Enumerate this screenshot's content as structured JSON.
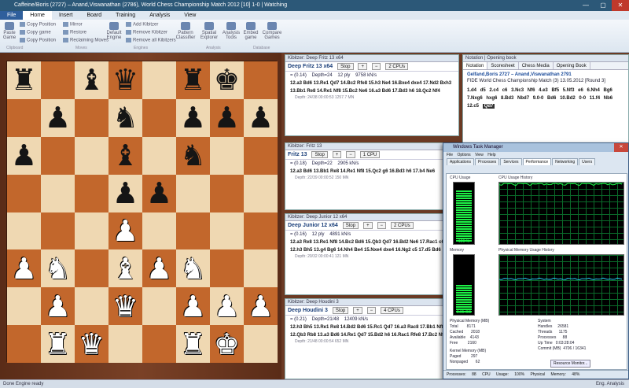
{
  "window": {
    "title": "Caffeine/Boris (2727) – Anand,Viswanathan (2786), World Chess Championship Match 2012 [10] 1-0 | Watching",
    "controls": [
      "—",
      "▢",
      "✕"
    ]
  },
  "menu": [
    "File",
    "Home",
    "Insert",
    "Board",
    "Training",
    "Analysis",
    "View"
  ],
  "ribbon": {
    "left_buttons": [
      "Paste Game",
      "Copy Game"
    ],
    "small_items": [
      "Copy Position",
      "Copy game",
      "Copy Position",
      "Mirror",
      "Restore",
      "Reclaiming Moves",
      "Add Kibitzer",
      "Remove Kibitzer",
      "Remove all Kibitzers"
    ],
    "buttons": [
      "Default Engine",
      "Pattern Classifier",
      "Spatial Explorer",
      "Analysis Tools",
      "Embed game",
      "Compare Games"
    ],
    "groups": [
      "Clipboard",
      "Moves",
      "Engines",
      "Analysis",
      "Database"
    ]
  },
  "board": [
    [
      "bR",
      "",
      "bB",
      "bQ",
      "",
      "bR",
      "bK",
      ""
    ],
    [
      "",
      "bP",
      "",
      "bN",
      "",
      "bP",
      "bP",
      "bP"
    ],
    [
      "bP",
      "",
      "",
      "bB",
      "",
      "bN",
      "",
      ""
    ],
    [
      "",
      "",
      "",
      "bP",
      "bP",
      "",
      "",
      ""
    ],
    [
      "",
      "",
      "",
      "wP",
      "",
      "",
      "",
      ""
    ],
    [
      "wP",
      "wN",
      "",
      "wB",
      "wP",
      "wN",
      "",
      ""
    ],
    [
      "",
      "wP",
      "",
      "wQ",
      "",
      "wP",
      "wP",
      "wP"
    ],
    [
      "",
      "wR",
      "wQ",
      "",
      "",
      "wR",
      "wK",
      ""
    ]
  ],
  "engines": [
    {
      "header": "Kibitzer: Deep Fritz 13 x64",
      "name": "Deep Fritz 13 x64",
      "buttons": [
        "Stop",
        "+",
        "−",
        "2 CPUs"
      ],
      "info": [
        "= (0.14)",
        "Depth=24",
        "12 ply",
        "9758 kN/s"
      ],
      "lines": [
        "12.a3 Bd6 13.Re1 Qd7 14.Bc2 Rfe8 15.h3 Ne4 16.Bxe4 dxe4 17.Nd2 Bxh3",
        "13.Bb1 Re8 14.Re1 Nf8 15.Bc2 Ne6 16.a3 Bd6 17.Bd3 h6 18.Qc2 Nf4"
      ],
      "depth": "Depth: 24/38 00:00:53 1257.7 MN"
    },
    {
      "header": "Kibitzer: Fritz 13",
      "name": "Fritz 13",
      "buttons": [
        "Stop",
        "+",
        "−",
        "1 CPU"
      ],
      "info": [
        "= (0.18)",
        "Depth=22",
        "2905 kN/s"
      ],
      "lines": [
        "12.a3 Bd6 13.Bb1 Re8 14.Re1 Nf8 15.Qc2 g6 16.Bd3 h6 17.b4 Ne6"
      ],
      "depth": "Depth: 22/39 00:00:52 150 MN"
    },
    {
      "header": "Kibitzer: Deep Junior 12 x64",
      "name": "Deep Junior 12 x64",
      "buttons": [
        "Stop",
        "+",
        "−",
        "2 CPUs"
      ],
      "info": [
        "= (0.16)",
        "12 ply",
        "4891 kN/s"
      ],
      "lines": [
        "12.a3 Re8 13.Re1 Nf8 14.Bc2 Bd6 15.Qb3 Qd7 16.Bd2 Ne6 17.Rac1 c6",
        "12.h3 Bh5 13.g4 Bg6 14.Nh4 Be4 15.Nxe4 dxe4 16.Ng2 c5 17.d5 Bd6"
      ],
      "depth": "Depth: 20/32 00:00:41 121 MN"
    },
    {
      "header": "Kibitzer: Deep Houdini 3",
      "name": "Deep Houdini 3",
      "buttons": [
        "Stop",
        "+",
        "−",
        "4 CPUs"
      ],
      "info": [
        "= (0.21)",
        "Depth=21/48",
        "12409 kN/s"
      ],
      "lines": [
        "12.h3 Bh5 13.Re1 Re8 14.Bd2 Bd6 15.Rc1 Qd7 16.a3 Rac8 17.Bb1 Nf8",
        "12.Qb3 Rb8 13.a3 Bd6 14.Re1 Qd7 15.Bd2 h6 16.Rac1 Rfe8 17.Bc2 Nf8"
      ],
      "depth": "Depth: 21/48 00:00:54 652 MN"
    }
  ],
  "notation": {
    "header": "Notation | Opening book",
    "tabs": [
      "Notation",
      "Scoresheet",
      "Chess Media",
      "Opening Book"
    ],
    "players": "Gelfand,Boris 2727 – Anand,Viswanathan 2791",
    "event": "FIDE World Chess Championship Match (3) 13.05.2012 [Round 3]",
    "moves": [
      "1.d4",
      "d5",
      "2.c4",
      "c6",
      "3.Nc3",
      "Nf6",
      "4.e3",
      "Bf5",
      "5.Nf3",
      "e6",
      "6.Nh4",
      "Bg6",
      "7.Nxg6",
      "hxg6",
      "8.Bd3",
      "Nbd7",
      "9.0-0",
      "Bd6",
      "10.Bd2",
      "0-0",
      "11.f4",
      "Nb6",
      "12.c5"
    ],
    "current_move": "Qd7"
  },
  "task_manager": {
    "title": "Windows Task Manager",
    "menu": [
      "File",
      "Options",
      "View",
      "Help"
    ],
    "tabs": [
      "Applications",
      "Processes",
      "Services",
      "Performance",
      "Networking",
      "Users"
    ],
    "active_tab": "Performance",
    "labels": [
      "CPU Usage",
      "CPU Usage History",
      "Memory",
      "Physical Memory Usage History"
    ],
    "cpu_level": 0.98,
    "cpu_text": "100 %",
    "mem_level": 0.6,
    "mem_text": "3.95 GB",
    "physical_memory": "Physical Memory (MB)\nTotal        8171\nCached       2018\nAvailable    4143\nFree         2160",
    "kernel_memory": "Kernel Memory (MB)\nPaged         297\nNonpaged       62",
    "system": "System\nHandles     26581\nThreads      1175\nProcesses      88\nUp Time   0:03:28:04\nCommit (MB)  4706 / 16341",
    "resource_button": "Resource Monitor...",
    "status": [
      "Processes: 88",
      "CPU Usage: 100%",
      "Physical Memory: 48%"
    ]
  },
  "status_bar": {
    "left": "Done  Engine ready",
    "right": "Eng. Analysis"
  }
}
